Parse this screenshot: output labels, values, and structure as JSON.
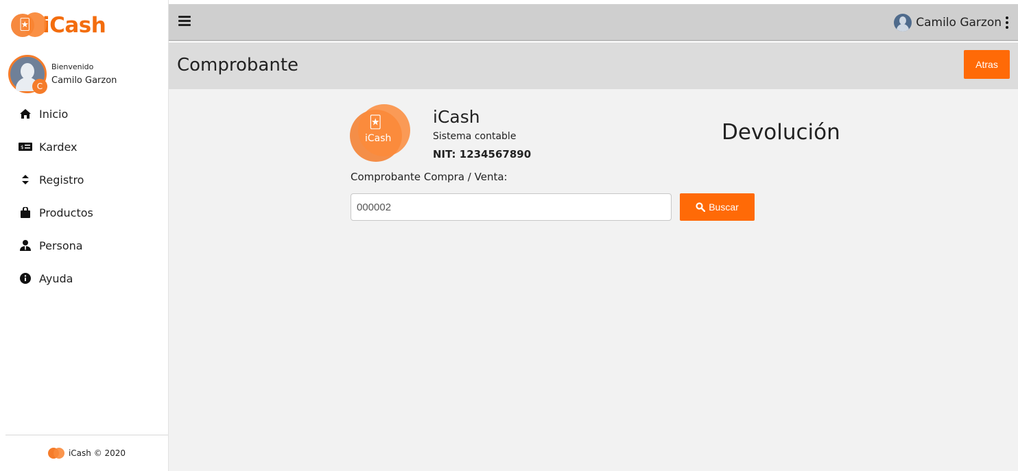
{
  "brand": {
    "name": "iCash"
  },
  "sidebar": {
    "welcome": "Bienvenido",
    "user_name": "Camilo Garzon",
    "avatar_badge": "C",
    "items": [
      {
        "label": "Inicio",
        "icon": "home-icon"
      },
      {
        "label": "Kardex",
        "icon": "money-icon"
      },
      {
        "label": "Registro",
        "icon": "sort-icon"
      },
      {
        "label": "Productos",
        "icon": "shopping-bag-icon"
      },
      {
        "label": "Persona",
        "icon": "user-tie-icon"
      },
      {
        "label": "Ayuda",
        "icon": "info-circle-icon"
      }
    ],
    "footer": "iCash © 2020"
  },
  "topbar": {
    "user_name": "Camilo Garzon"
  },
  "header": {
    "title": "Comprobante",
    "back_label": "Atras"
  },
  "company": {
    "name": "iCash",
    "subtitle": "Sistema contable",
    "nit": "NIT: 1234567890",
    "logo_text": "iCash"
  },
  "document": {
    "title": "Devolución"
  },
  "search": {
    "label": "Comprobante Compra / Venta:",
    "value": "000002",
    "button_label": "Buscar"
  },
  "colors": {
    "accent": "#ff6a07",
    "topbar": "#cfcfcf",
    "content_bg": "#f2f2f2"
  }
}
